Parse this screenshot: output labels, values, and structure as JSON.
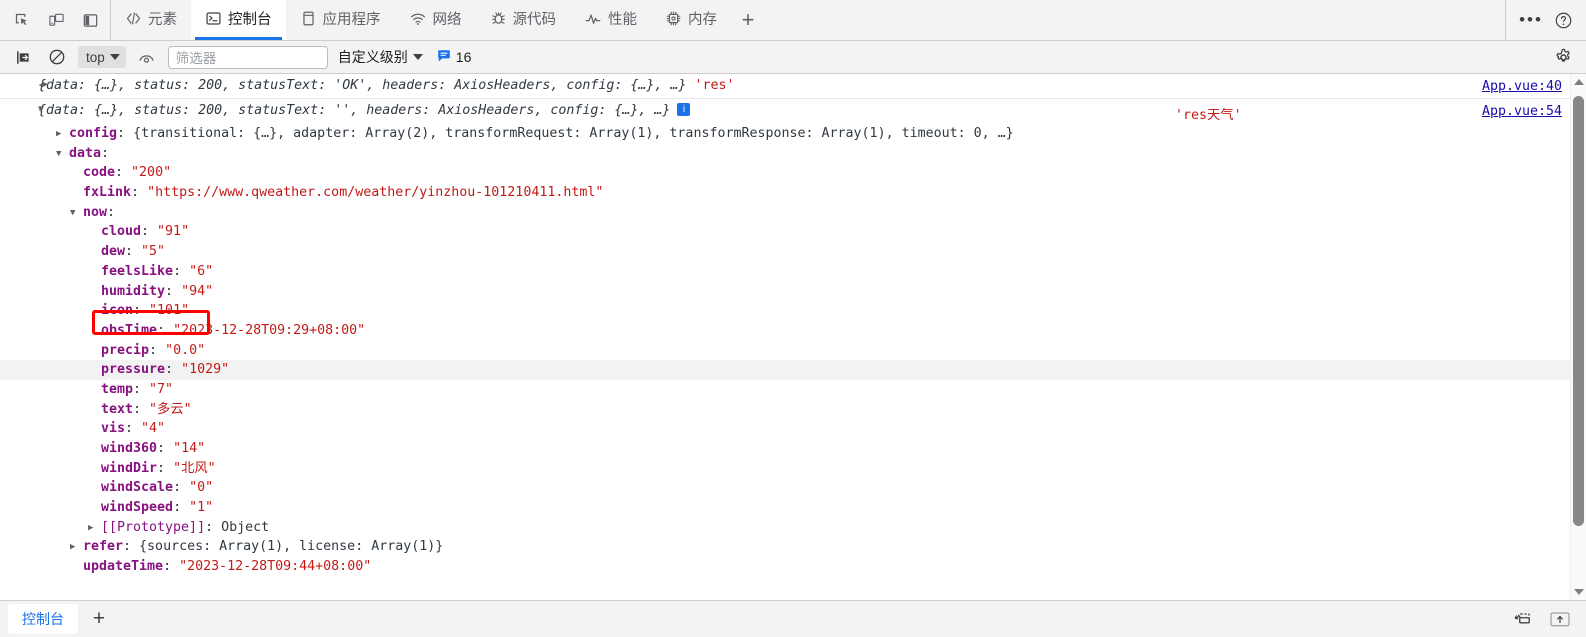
{
  "window": {
    "tool_icons": [
      "inspect-element-icon",
      "device-toolbar-icon",
      "dock-side-icon"
    ],
    "more_label": "•••",
    "tabs": [
      {
        "label": "元素",
        "icon": "elements-icon",
        "active": false
      },
      {
        "label": "控制台",
        "icon": "console-icon",
        "active": true
      },
      {
        "label": "应用程序",
        "icon": "application-icon",
        "active": false
      },
      {
        "label": "网络",
        "icon": "network-icon",
        "active": false
      },
      {
        "label": "源代码",
        "icon": "sources-icon",
        "active": false
      },
      {
        "label": "性能",
        "icon": "performance-icon",
        "active": false
      },
      {
        "label": "内存",
        "icon": "memory-icon",
        "active": false
      }
    ],
    "add_tab_label": "+"
  },
  "toolbar": {
    "clear_console": "clear-console-icon",
    "no_entry": "no-entry-icon",
    "context": "top",
    "eye_icon": "live-expression-icon",
    "filter_placeholder": "筛选器",
    "filter_value": "",
    "level": "自定义级别",
    "info_count": "16",
    "settings_icon": "gear-icon"
  },
  "console": {
    "messages": [
      {
        "arrow": "▶",
        "summary": "{data: {…}, status: 200, statusText: 'OK', headers: AxiosHeaders, config: {…}, …}",
        "label": "'res'",
        "source": "App.vue:40"
      },
      {
        "arrow": "▼",
        "summary": "{data: {…}, status: 200, statusText: '', headers: AxiosHeaders, config: {…}, …}",
        "badge": "i",
        "label_right": "'res天气'",
        "source": "App.vue:54"
      }
    ],
    "tree": [
      {
        "indent": 1,
        "arrow": "▶",
        "key": "config",
        "sep": ": ",
        "value": "{transitional: {…}, adapter: Array(2), transformRequest: Array(1), transformResponse: Array(1), timeout: 0, …}",
        "vtype": "plain"
      },
      {
        "indent": 1,
        "arrow": "▼",
        "key": "data",
        "sep": ":",
        "value": "",
        "vtype": "plain"
      },
      {
        "indent": 2,
        "arrow": "",
        "key": "code",
        "sep": ": ",
        "value": "\"200\"",
        "vtype": "str"
      },
      {
        "indent": 2,
        "arrow": "",
        "key": "fxLink",
        "sep": ": ",
        "value": "\"https://www.qweather.com/weather/yinzhou-101210411.html\"",
        "vtype": "str"
      },
      {
        "indent": 2,
        "arrow": "▼",
        "key": "now",
        "sep": ":",
        "value": "",
        "vtype": "plain"
      },
      {
        "indent": 3,
        "arrow": "",
        "key": "cloud",
        "sep": ": ",
        "value": "\"91\"",
        "vtype": "str"
      },
      {
        "indent": 3,
        "arrow": "",
        "key": "dew",
        "sep": ": ",
        "value": "\"5\"",
        "vtype": "str"
      },
      {
        "indent": 3,
        "arrow": "",
        "key": "feelsLike",
        "sep": ": ",
        "value": "\"6\"",
        "vtype": "str"
      },
      {
        "indent": 3,
        "arrow": "",
        "key": "humidity",
        "sep": ": ",
        "value": "\"94\"",
        "vtype": "str"
      },
      {
        "indent": 3,
        "arrow": "",
        "key": "icon",
        "sep": ": ",
        "value": "\"101\"",
        "vtype": "str",
        "annotated": true
      },
      {
        "indent": 3,
        "arrow": "",
        "key": "obsTime",
        "sep": ": ",
        "value": "\"2023-12-28T09:29+08:00\"",
        "vtype": "str"
      },
      {
        "indent": 3,
        "arrow": "",
        "key": "precip",
        "sep": ": ",
        "value": "\"0.0\"",
        "vtype": "str"
      },
      {
        "indent": 3,
        "arrow": "",
        "key": "pressure",
        "sep": ": ",
        "value": "\"1029\"",
        "vtype": "str",
        "highlighted": true
      },
      {
        "indent": 3,
        "arrow": "",
        "key": "temp",
        "sep": ": ",
        "value": "\"7\"",
        "vtype": "str"
      },
      {
        "indent": 3,
        "arrow": "",
        "key": "text",
        "sep": ": ",
        "value": "\"多云\"",
        "vtype": "str"
      },
      {
        "indent": 3,
        "arrow": "",
        "key": "vis",
        "sep": ": ",
        "value": "\"4\"",
        "vtype": "str"
      },
      {
        "indent": 3,
        "arrow": "",
        "key": "wind360",
        "sep": ": ",
        "value": "\"14\"",
        "vtype": "str"
      },
      {
        "indent": 3,
        "arrow": "",
        "key": "windDir",
        "sep": ": ",
        "value": "\"北风\"",
        "vtype": "str"
      },
      {
        "indent": 3,
        "arrow": "",
        "key": "windScale",
        "sep": ": ",
        "value": "\"0\"",
        "vtype": "str"
      },
      {
        "indent": 3,
        "arrow": "",
        "key": "windSpeed",
        "sep": ": ",
        "value": "\"1\"",
        "vtype": "str"
      },
      {
        "indent": 3,
        "arrow": "▶",
        "key": "[[Prototype]]",
        "sep": ": ",
        "value": "Object",
        "vtype": "plain",
        "proto": true
      },
      {
        "indent": 2,
        "arrow": "▶",
        "key": "refer",
        "sep": ": ",
        "value": "{sources: Array(1), license: Array(1)}",
        "vtype": "plain"
      },
      {
        "indent": 2,
        "arrow": "",
        "key": "updateTime",
        "sep": ": ",
        "value": "\"2023-12-28T09:44+08:00\"",
        "vtype": "str"
      }
    ]
  },
  "drawer": {
    "tab_label": "控制台",
    "add_label": "+",
    "right_icons": [
      "restore-drawer-icon",
      "dock-drawer-icon"
    ]
  },
  "colors": {
    "accent": "#1a73e8",
    "key": "#881280",
    "string": "#c41a16",
    "number": "#1c00cf",
    "link": "#1a0dab",
    "annotation": "#ff0000"
  }
}
